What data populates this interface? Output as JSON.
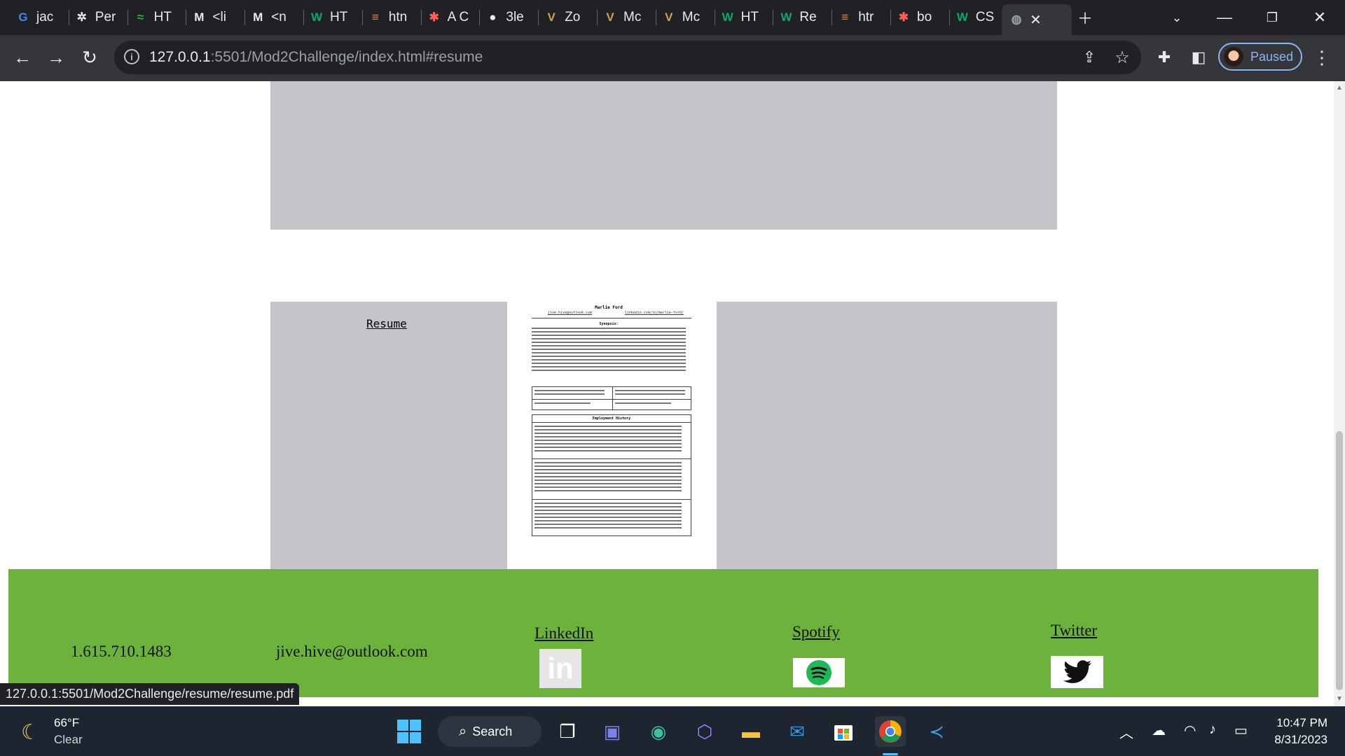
{
  "browser": {
    "tabs": [
      {
        "label": "jac",
        "icon": "google-icon"
      },
      {
        "label": "Per",
        "icon": "openai-icon"
      },
      {
        "label": "HT",
        "icon": "tab-icon"
      },
      {
        "label": "<li",
        "icon": "mdn-icon"
      },
      {
        "label": "<n",
        "icon": "mdn-icon"
      },
      {
        "label": "HT",
        "icon": "w3schools-icon"
      },
      {
        "label": "htn",
        "icon": "stackoverflow-icon"
      },
      {
        "label": "A C",
        "icon": "asterisk-icon"
      },
      {
        "label": "3le",
        "icon": "github-icon"
      },
      {
        "label": "Zo",
        "icon": "vanderbilt-icon"
      },
      {
        "label": "Mc",
        "icon": "vanderbilt-icon"
      },
      {
        "label": "Mc",
        "icon": "vanderbilt-icon"
      },
      {
        "label": "HT",
        "icon": "w3schools-icon"
      },
      {
        "label": "Re",
        "icon": "w3schools-icon"
      },
      {
        "label": "htr",
        "icon": "stackoverflow-icon"
      },
      {
        "label": "bo",
        "icon": "asterisk-icon"
      },
      {
        "label": "CS",
        "icon": "w3schools-icon"
      }
    ],
    "url_host": "127.0.0.1",
    "url_path": ":5501/Mod2Challenge/index.html#resume",
    "profile_label": "Paused",
    "status_url": "127.0.0.1:5501/Mod2Challenge/resume/resume.pdf"
  },
  "page": {
    "resume_link": "Resume",
    "resume_doc": {
      "name": "Marlie Ford",
      "email": "jive.hive@outlook.com",
      "linkedin": "linkedin.com/in/marlie-ford/",
      "synopsis_heading": "Synopsis:",
      "employment_heading": "Employment History"
    },
    "footer": {
      "phone": "1.615.710.1483",
      "email": "jive.hive@outlook.com",
      "linkedin": "LinkedIn",
      "spotify": "Spotify",
      "twitter": "Twitter"
    }
  },
  "taskbar": {
    "temperature": "66°F",
    "condition": "Clear",
    "search_label": "Search",
    "time": "10:47 PM",
    "date": "8/31/2023"
  },
  "colors": {
    "footer_bg": "#6db23c",
    "panel_gray": "#c5c4c9",
    "spotify_green": "#1db954"
  }
}
